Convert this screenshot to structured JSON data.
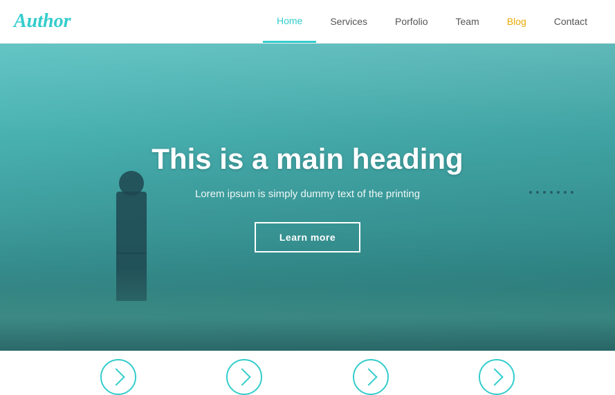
{
  "navbar": {
    "brand": "Author",
    "nav_items": [
      {
        "label": "Home",
        "active": true,
        "special": ""
      },
      {
        "label": "Services",
        "active": false,
        "special": ""
      },
      {
        "label": "Porfolio",
        "active": false,
        "special": ""
      },
      {
        "label": "Team",
        "active": false,
        "special": ""
      },
      {
        "label": "Blog",
        "active": false,
        "special": "blog"
      },
      {
        "label": "Contact",
        "active": false,
        "special": ""
      }
    ]
  },
  "hero": {
    "heading": "This is a main heading",
    "subtext": "Lorem ipsum is simply dummy text of the printing",
    "button_label": "Learn more"
  },
  "bottom": {
    "circles": [
      "icon1",
      "icon2",
      "icon3",
      "icon4"
    ]
  }
}
